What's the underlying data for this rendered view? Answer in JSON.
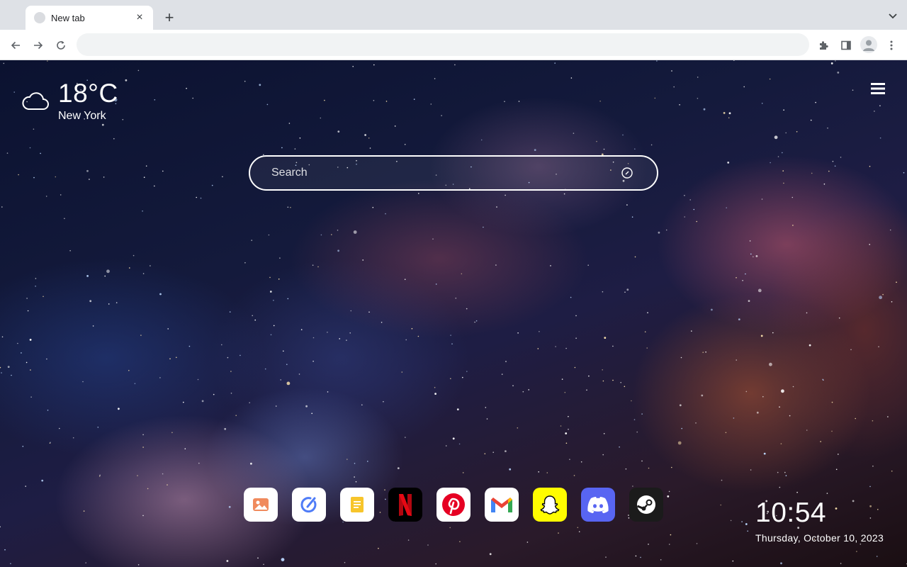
{
  "browser": {
    "tab": {
      "title": "New tab",
      "close_icon": "×"
    },
    "new_tab_icon": "+",
    "omnibox": {
      "value": "",
      "placeholder": ""
    }
  },
  "weather": {
    "temperature": "18°C",
    "city": "New York",
    "icon": "cloud-icon"
  },
  "search": {
    "placeholder": "Search"
  },
  "dock": [
    {
      "name": "photos",
      "icon": "image-icon",
      "bg": "#ffffff"
    },
    {
      "name": "edit",
      "icon": "pen-icon",
      "bg": "#ffffff"
    },
    {
      "name": "notes",
      "icon": "note-icon",
      "bg": "#ffffff"
    },
    {
      "name": "netflix",
      "icon": "netflix-icon",
      "bg": "#000000"
    },
    {
      "name": "pinterest",
      "icon": "pinterest-icon",
      "bg": "#ffffff"
    },
    {
      "name": "gmail",
      "icon": "gmail-icon",
      "bg": "#ffffff"
    },
    {
      "name": "snapchat",
      "icon": "snapchat-icon",
      "bg": "#fffc00"
    },
    {
      "name": "discord",
      "icon": "discord-icon",
      "bg": "#5865f2"
    },
    {
      "name": "steam",
      "icon": "steam-icon",
      "bg": "#1b1b1b"
    }
  ],
  "clock": {
    "time": "10:54",
    "date": "Thursday, October 10, 2023"
  },
  "colors": {
    "chrome_bg": "#dee1e6",
    "toolbar_bg": "#ffffff",
    "text_on_bg": "#ffffff"
  }
}
